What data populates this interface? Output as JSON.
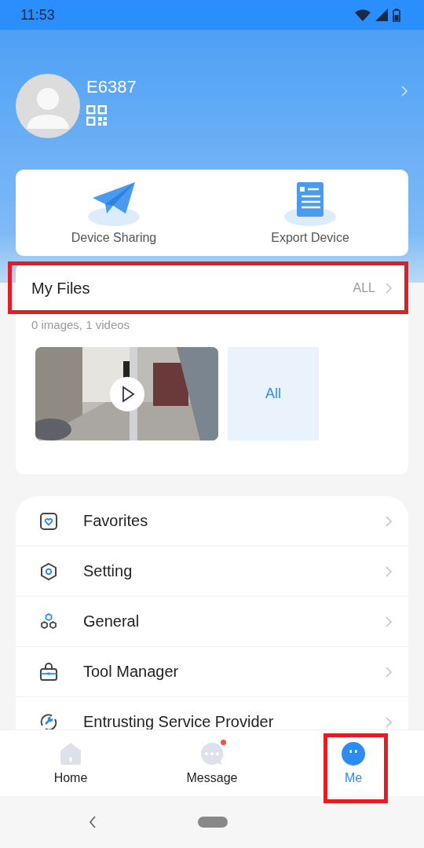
{
  "status_bar": {
    "time": "11:53"
  },
  "profile": {
    "name": "E6387"
  },
  "quick_actions": [
    {
      "kind": "share",
      "label": "Device Sharing"
    },
    {
      "kind": "export",
      "label": "Export Device"
    }
  ],
  "my_files": {
    "title": "My Files",
    "link": "ALL",
    "highlighted": true,
    "summary": "0 images, 1 videos",
    "thumbnails": [
      {
        "kind": "video"
      },
      {
        "kind": "all",
        "label": "All"
      }
    ]
  },
  "menu": [
    {
      "kind": "favorites",
      "label": "Favorites"
    },
    {
      "kind": "setting",
      "label": "Setting"
    },
    {
      "kind": "general",
      "label": "General"
    },
    {
      "kind": "tools",
      "label": "Tool Manager"
    },
    {
      "kind": "provider",
      "label": "Entrusting Service Provider"
    }
  ],
  "tabs": [
    {
      "kind": "home",
      "label": "Home",
      "selected": false,
      "highlighted": false,
      "dot": false
    },
    {
      "kind": "message",
      "label": "Message",
      "selected": false,
      "highlighted": false,
      "dot": true
    },
    {
      "kind": "me",
      "label": "Me",
      "selected": true,
      "highlighted": true,
      "dot": false
    }
  ]
}
